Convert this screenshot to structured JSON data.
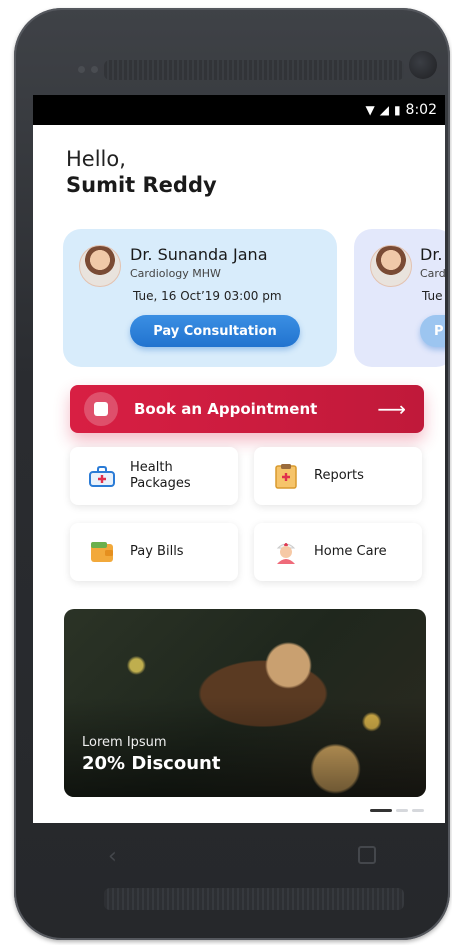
{
  "status_bar": {
    "time": "8:02",
    "icons": [
      "wifi-icon",
      "signal-icon",
      "battery-icon"
    ]
  },
  "greeting": {
    "hello": "Hello,",
    "name": "Sumit Reddy"
  },
  "doctor_cards": [
    {
      "name": "Dr. Sunanda Jana",
      "specialty": "Cardiology MHW",
      "datetime": "Tue, 16 Oct’19 03:00 pm",
      "button": "Pay Consultation"
    },
    {
      "name": "Dr.",
      "specialty": "Card",
      "datetime": "Tue",
      "button": "P"
    }
  ],
  "book_appointment": {
    "label": "Book an Appointment",
    "arrow": "⟶"
  },
  "tiles": [
    {
      "label": "Health Packages",
      "icon": "health-package-icon"
    },
    {
      "label": "Reports",
      "icon": "clipboard-report-icon"
    },
    {
      "label": "Pay Bills",
      "icon": "wallet-icon"
    },
    {
      "label": "Home Care",
      "icon": "nurse-icon"
    }
  ],
  "promo": {
    "subtitle": "Lorem Ipsum",
    "title": "20% Discount"
  },
  "carousel": {
    "active_index": 0,
    "count": 3
  },
  "colors": {
    "accent_blue": "#2173cf",
    "accent_red": "#d81f43",
    "card_blue": "#d8ecfb"
  }
}
